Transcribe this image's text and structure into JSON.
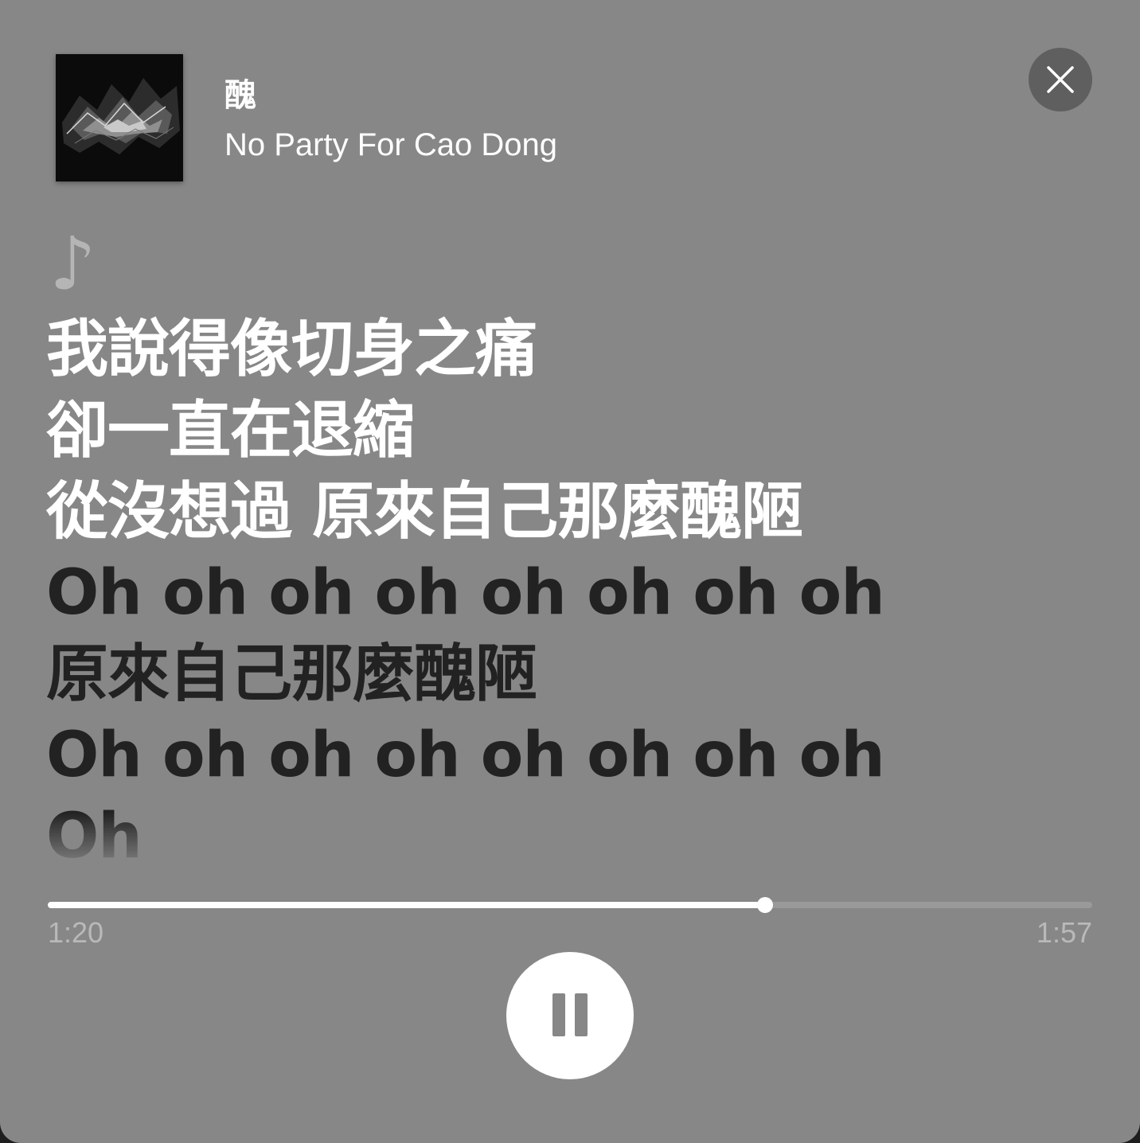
{
  "track": {
    "title": "醜",
    "artist": "No Party For Cao Dong"
  },
  "icons": {
    "close": "close-icon",
    "note": "music-note-icon",
    "play_state": "pause-icon"
  },
  "note_glyph": "♪",
  "lyrics": [
    {
      "text": "我說得像切身之痛",
      "state": "sung"
    },
    {
      "text": "卻一直在退縮",
      "state": "sung"
    },
    {
      "text": "從沒想過 原來自己那麼醜陋",
      "state": "sung"
    },
    {
      "text": "Oh oh oh oh oh oh oh oh",
      "state": "upcoming"
    },
    {
      "text": "原來自己那麼醜陋",
      "state": "upcoming"
    },
    {
      "text": "Oh oh oh oh oh oh oh oh",
      "state": "upcoming"
    },
    {
      "text": "Oh",
      "state": "fade"
    }
  ],
  "playback": {
    "elapsed": "1:20",
    "total": "1:57",
    "progress": 0.687
  },
  "colors": {
    "background": "#878787",
    "sung_lyric": "#ffffff",
    "upcoming_lyric": "#222222",
    "close_button": "#5f5f5f"
  }
}
